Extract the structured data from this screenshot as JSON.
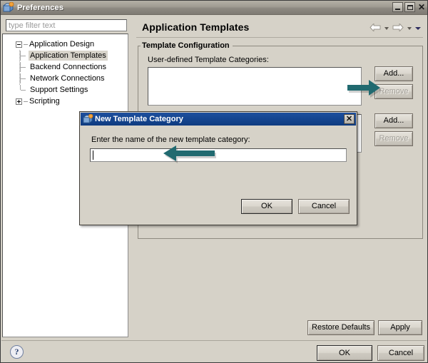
{
  "window": {
    "title": "Preferences",
    "icon": "preferences-app-icon",
    "controls": {
      "minimize": "minimize-icon",
      "maximize": "maximize-icon",
      "close": "✕"
    }
  },
  "sidebar": {
    "filter": {
      "placeholder": "type filter text",
      "value": ""
    },
    "tree": [
      {
        "label": "Application Design",
        "state": "expanded",
        "children": [
          {
            "label": "Application Templates",
            "selected": true
          },
          {
            "label": "Backend Connections",
            "selected": false
          },
          {
            "label": "Network Connections",
            "selected": false
          },
          {
            "label": "Support Settings",
            "selected": false
          }
        ]
      },
      {
        "label": "Scripting",
        "state": "collapsed",
        "children": []
      }
    ]
  },
  "main": {
    "page_title": "Application Templates",
    "nav": {
      "back": "back-arrow-icon",
      "back_menu": "chevron-down-icon",
      "forward": "forward-arrow-icon",
      "forward_menu": "chevron-down-icon",
      "view_menu": "chevron-down-icon"
    },
    "group": {
      "title": "Template Configuration"
    },
    "fields": [
      {
        "label": "User-defined Template Categories:",
        "list_value": "",
        "add_label": "Add...",
        "remove_label": "Remove",
        "remove_disabled": true
      },
      {
        "label": "",
        "list_value": "",
        "add_label": "Add...",
        "remove_label": "Remove",
        "remove_disabled": true
      }
    ],
    "footer_buttons": {
      "restore_defaults": "Restore Defaults",
      "apply": "Apply"
    }
  },
  "dialog": {
    "title": "New Template Category",
    "icon": "new-template-category-icon",
    "close_glyph": "✕",
    "prompt": "Enter the name of the new template category:",
    "input": {
      "value": "",
      "placeholder": ""
    },
    "ok_label": "OK",
    "cancel_label": "Cancel"
  },
  "bottom_bar": {
    "help": "?",
    "ok_label": "OK",
    "cancel_label": "Cancel"
  },
  "annotations": {
    "arrow_color": "#216a70",
    "arrow_to_add": "right-pointing-arrow",
    "arrow_to_input": "left-pointing-arrow"
  }
}
